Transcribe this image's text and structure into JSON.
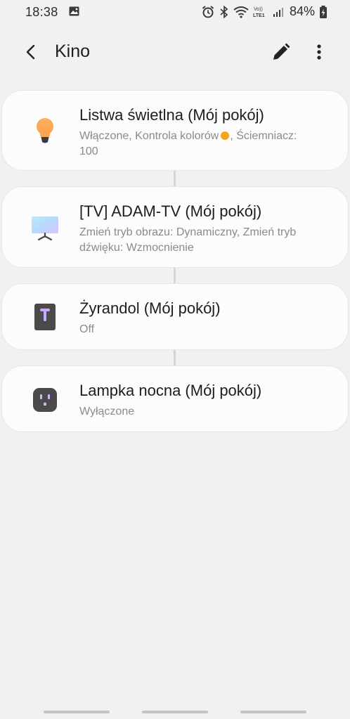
{
  "status_bar": {
    "time": "18:38",
    "network_label": "Vo))\nLTE1",
    "battery": "84%"
  },
  "header": {
    "title": "Kino"
  },
  "devices": [
    {
      "title": "Listwa świetlna (Mój pokój)",
      "status_before_dot": "Włączone, Kontrola kolorów",
      "status_after_dot": ", Ściemniacz:",
      "status_line2": "100",
      "color_dot": "#f7a417",
      "icon": "lightbulb-icon"
    },
    {
      "title": "[TV] ADAM-TV (Mój pokój)",
      "status_line1": "Zmień tryb obrazu: Dynamiczny, Zmień tryb",
      "status_line2": "dźwięku: Wzmocnienie",
      "icon": "tv-icon"
    },
    {
      "title": "Żyrandol (Mój pokój)",
      "status_line1": "Off",
      "icon": "wall-switch-icon"
    },
    {
      "title": "Lampka nocna (Mój pokój)",
      "status_line1": "Wyłączone",
      "icon": "smart-plug-icon"
    }
  ],
  "colors": {
    "background": "#f1f1f1",
    "card": "#fcfcfc",
    "accent_dot": "#f7a417"
  }
}
